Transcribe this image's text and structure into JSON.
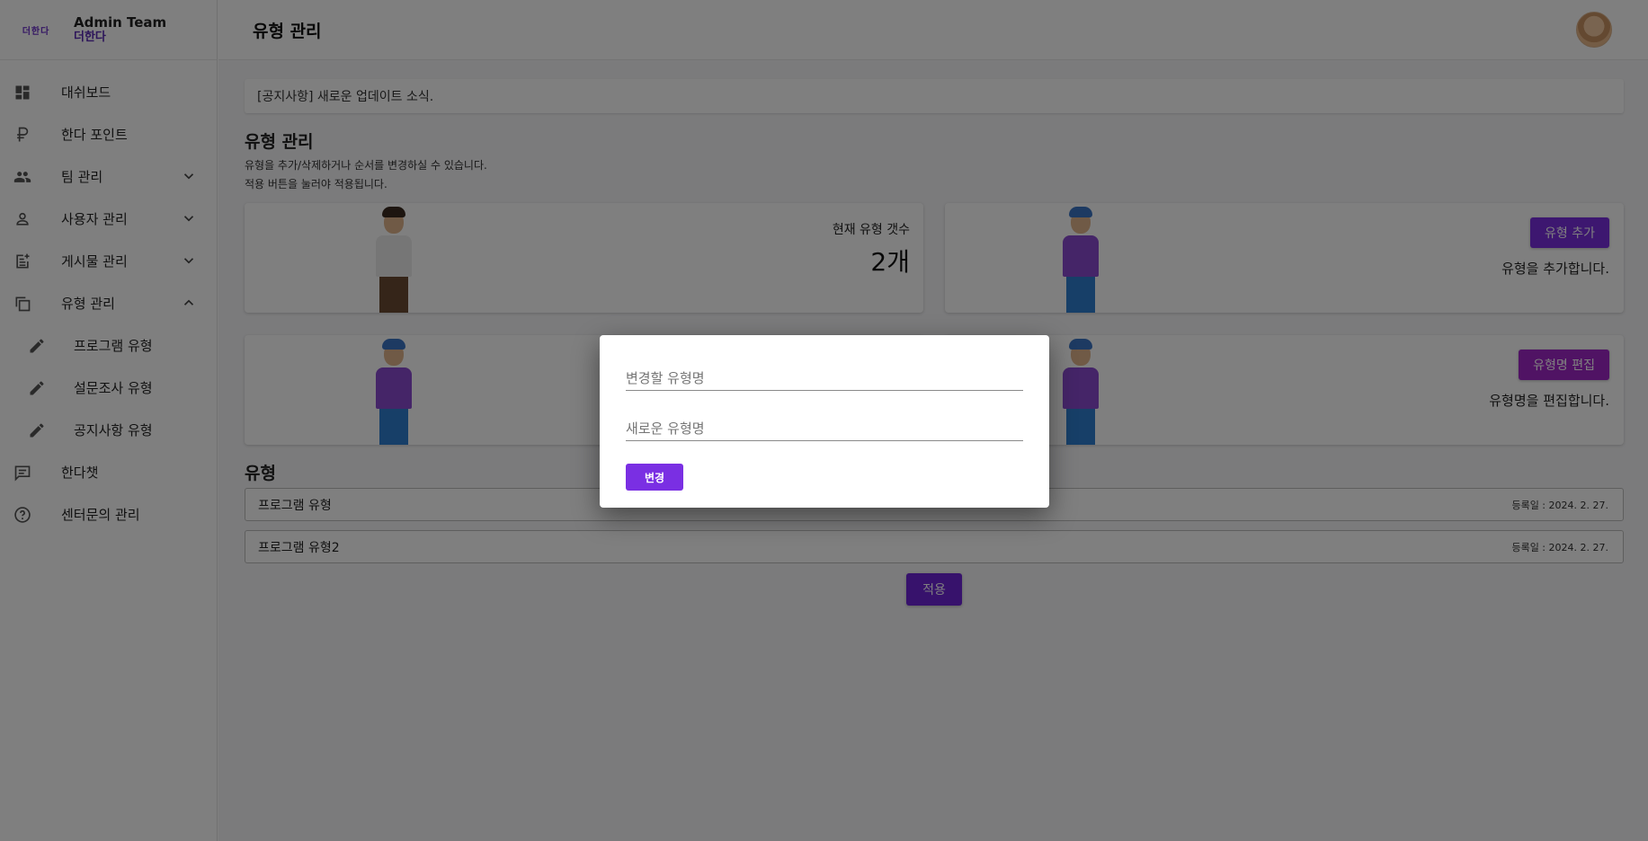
{
  "brand": {
    "logo_text": "더한다",
    "title": "Admin Team",
    "subtitle": "더한다"
  },
  "header": {
    "title": "유형 관리"
  },
  "sidebar": {
    "items": [
      {
        "label": "대쉬보드",
        "icon": "dashboard-icon"
      },
      {
        "label": "한다 포인트",
        "icon": "ruble-currency-icon"
      },
      {
        "label": "팀 관리",
        "icon": "people-icon",
        "expanded": false
      },
      {
        "label": "사용자 관리",
        "icon": "person-icon",
        "expanded": false
      },
      {
        "label": "게시물 관리",
        "icon": "post-add-icon",
        "expanded": false
      },
      {
        "label": "유형 관리",
        "icon": "copy-icon",
        "expanded": true
      },
      {
        "label": "프로그램 유형",
        "icon": "pencil-icon"
      },
      {
        "label": "설문조사 유형",
        "icon": "pencil-icon"
      },
      {
        "label": "공지사항 유형",
        "icon": "pencil-icon"
      },
      {
        "label": "한다챗",
        "icon": "chat-icon"
      },
      {
        "label": "센터문의 관리",
        "icon": "help-circle-icon"
      }
    ]
  },
  "main": {
    "notice": "[공지사항] 새로운 업데이트 소식.",
    "section_title": "유형 관리",
    "description_line1": "유형을 추가/삭제하거나 순서를 변경하실 수 있습니다.",
    "description_line2": "적용 버튼을 눌러야 적용됩니다.",
    "count_card": {
      "label": "현재 유형 갯수",
      "value": "2개"
    },
    "add_card": {
      "button": "유형 추가",
      "caption": "유형을 추가합니다."
    },
    "edit_card": {
      "button": "유형명 편집",
      "caption": "유형명을 편집합니다."
    },
    "list_title": "유형",
    "types": [
      {
        "name": "프로그램 유형",
        "date": "등록일 : 2024. 2. 27."
      },
      {
        "name": "프로그램 유형2",
        "date": "등록일 : 2024. 2. 27."
      }
    ],
    "apply_button": "적용"
  },
  "dialog": {
    "old_name_placeholder": "변경할 유형명",
    "new_name_placeholder": "새로운 유형명",
    "old_name_value": "",
    "new_name_value": "",
    "submit_label": "변경"
  },
  "colors": {
    "accent": "#7a2fe3",
    "edit_button": "#a127c9",
    "brand_purple": "#5b2bb5"
  }
}
